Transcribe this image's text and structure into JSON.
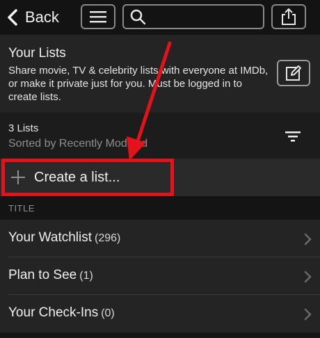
{
  "topbar": {
    "back_label": "Back",
    "search_placeholder": ""
  },
  "lists": {
    "title": "Your Lists",
    "description": "Share movie, TV & celebrity lists with everyone at IMDb, or make it private just for you. Must be logged in to create lists."
  },
  "count_bar": {
    "count": "3 Lists",
    "sort": "Sorted by Recently Modified"
  },
  "create": {
    "label": "Create a list..."
  },
  "table": {
    "header": "TITLE",
    "rows": [
      {
        "name": "Your Watchlist",
        "count": "(296)"
      },
      {
        "name": "Plan to See",
        "count": "(1)"
      },
      {
        "name": "Your Check-Ins",
        "count": "(0)"
      }
    ]
  },
  "colors": {
    "highlight": "#e3131b",
    "background": "#161616"
  }
}
